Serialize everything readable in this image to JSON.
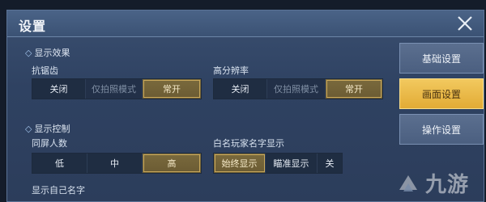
{
  "window": {
    "title": "设置"
  },
  "display_effect": {
    "section_title": "显示效果",
    "antialias": {
      "label": "抗锯齿",
      "options": [
        "关闭",
        "仅拍照模式",
        "常开"
      ],
      "selected": "常开"
    },
    "high_res": {
      "label": "高分辨率",
      "options": [
        "关闭",
        "仅拍照模式",
        "常开"
      ],
      "selected": "常开"
    }
  },
  "display_control": {
    "section_title": "显示控制",
    "same_screen": {
      "label": "同屏人数",
      "options": [
        "低",
        "中",
        "高"
      ],
      "selected": "高"
    },
    "white_name": {
      "label": "白名玩家名字显示",
      "options": [
        "始终显示",
        "瞄准显示",
        "关"
      ],
      "selected": "始终显示"
    },
    "own_name": {
      "label": "显示自己名字"
    }
  },
  "sidebar": {
    "tabs": [
      {
        "label": "基础设置",
        "active": false
      },
      {
        "label": "画面设置",
        "active": true
      },
      {
        "label": "操作设置",
        "active": false
      }
    ]
  },
  "watermark": {
    "text": "九游"
  },
  "icons": {
    "close": "close-icon",
    "logo": "logo-icon"
  },
  "colors": {
    "accent": "#e2ab35",
    "active_option": "#6b5b33",
    "panel": "#2f4262"
  }
}
